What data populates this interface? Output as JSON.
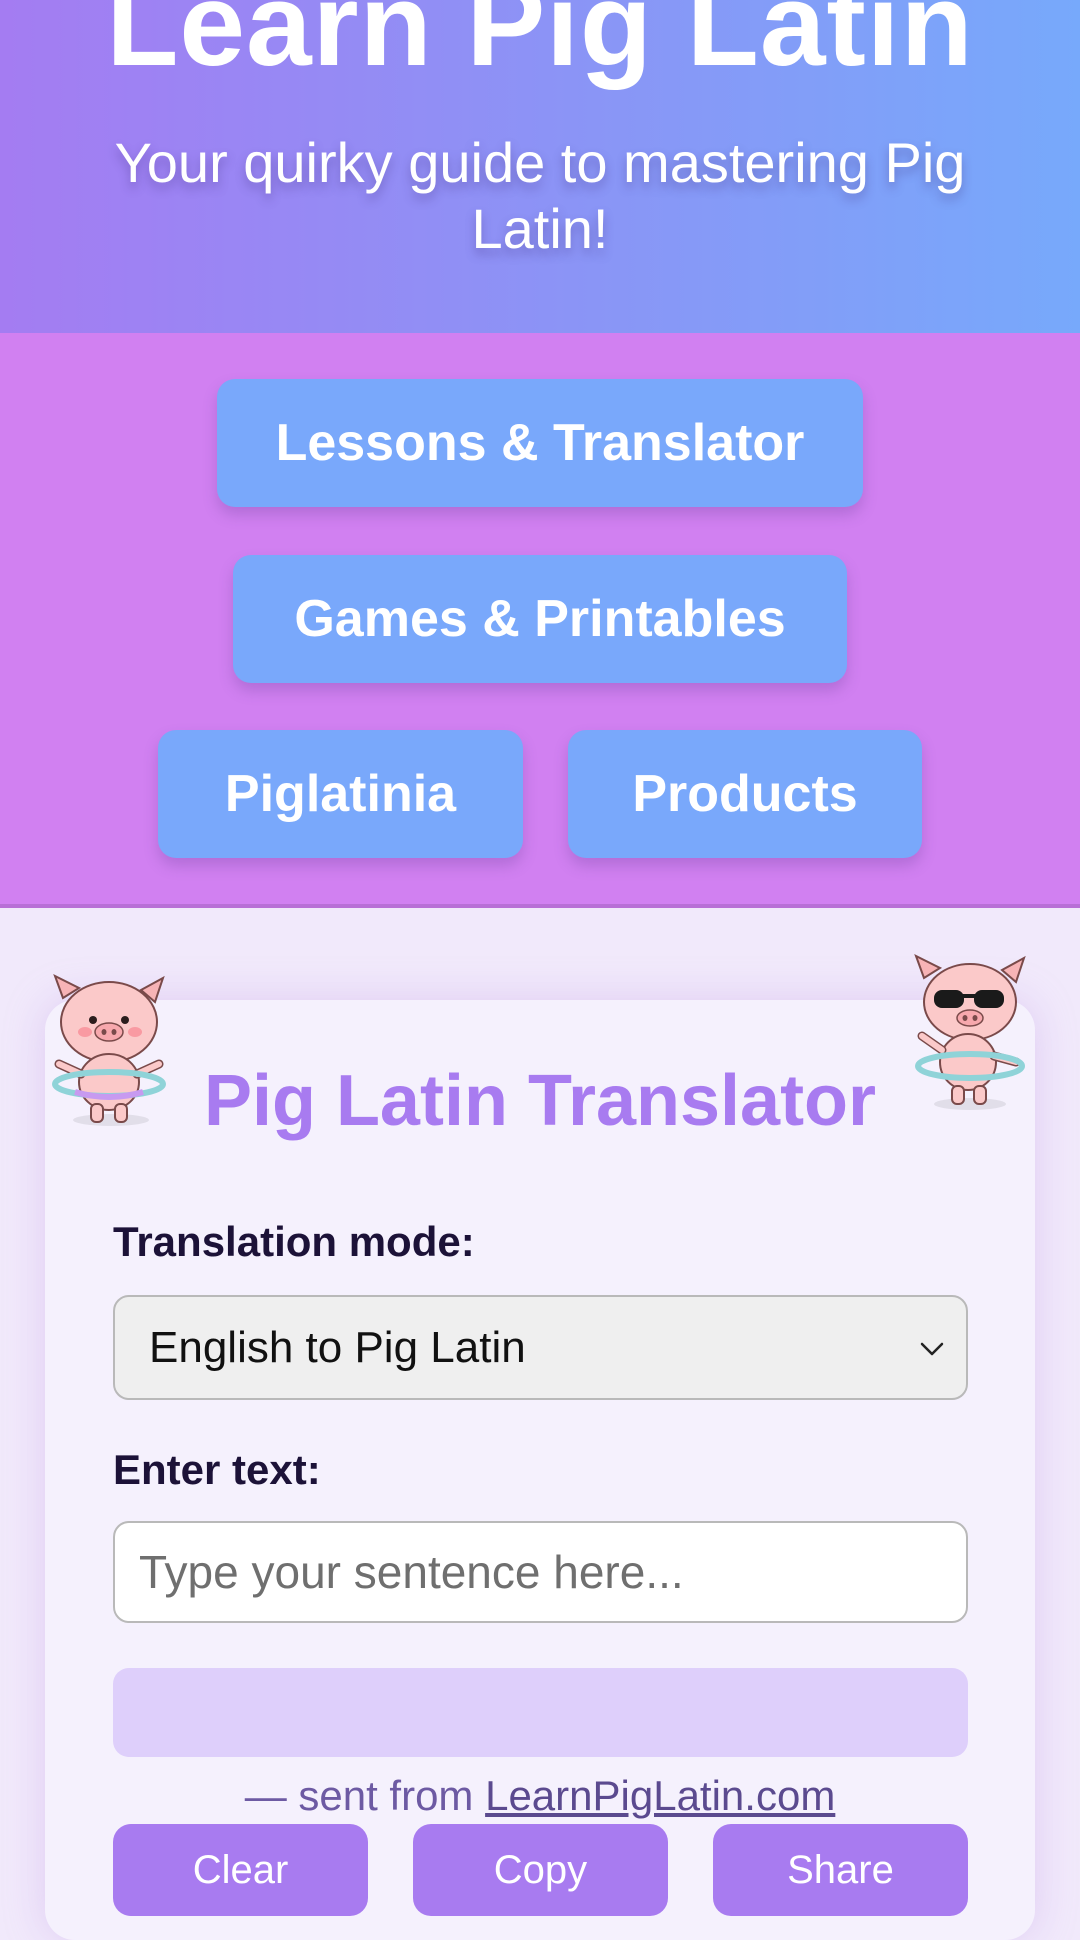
{
  "header": {
    "title": "Learn Pig Latin",
    "tagline": "Your quirky guide to mastering Pig Latin!"
  },
  "nav": {
    "lessons": "Lessons & Translator",
    "games": "Games & Printables",
    "piglatinia": "Piglatinia",
    "products": "Products"
  },
  "translator": {
    "title": "Pig Latin Translator",
    "mode_label": "Translation mode:",
    "mode_value": "English to Pig Latin",
    "text_label": "Enter text:",
    "input_placeholder": "Type your sentence here...",
    "input_value": "",
    "output_text": "",
    "footer_prefix": "— sent from ",
    "footer_link": "LearnPigLatin.com",
    "buttons": {
      "clear": "Clear",
      "copy": "Copy",
      "share": "Share"
    }
  },
  "icons": {
    "select": "chevron-down-icon",
    "pig_left": "pig-hula-hoop-icon",
    "pig_right": "pig-sunglasses-hula-hoop-icon"
  },
  "colors": {
    "header_start": "#a47cf2",
    "header_end": "#77a9fb",
    "nav_bg": "#d180f1",
    "nav_button": "#79a8fb",
    "accent_purple": "#a87bf0",
    "output_bg": "#decffb"
  }
}
